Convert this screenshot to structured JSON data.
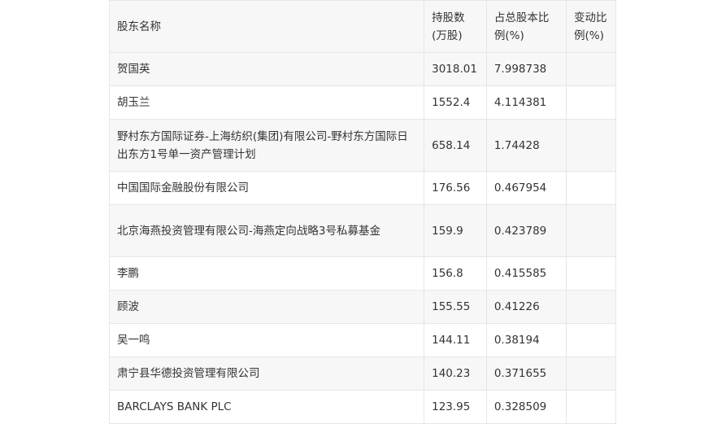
{
  "table": {
    "headers": [
      "股东名称",
      "持股数(万股)",
      "占总股本比例(%)",
      "变动比例(%)"
    ],
    "rows": [
      {
        "name": "贺国英",
        "shares": "3018.01",
        "ratio": "7.998738",
        "change": ""
      },
      {
        "name": "胡玉兰",
        "shares": "1552.4",
        "ratio": "4.114381",
        "change": ""
      },
      {
        "name": "野村东方国际证券-上海纺织(集团)有限公司-野村东方国际日出东方1号单一资产管理计划",
        "shares": "658.14",
        "ratio": "1.74428",
        "change": ""
      },
      {
        "name": "中国国际金融股份有限公司",
        "shares": "176.56",
        "ratio": "0.467954",
        "change": ""
      },
      {
        "name": "北京海燕投资管理有限公司-海燕定向战略3号私募基金",
        "shares": "159.9",
        "ratio": "0.423789",
        "change": ""
      },
      {
        "name": "李鹏",
        "shares": "156.8",
        "ratio": "0.415585",
        "change": ""
      },
      {
        "name": "顾波",
        "shares": "155.55",
        "ratio": "0.41226",
        "change": ""
      },
      {
        "name": "吴一鸣",
        "shares": "144.11",
        "ratio": "0.38194",
        "change": ""
      },
      {
        "name": "肃宁县华德投资管理有限公司",
        "shares": "140.23",
        "ratio": "0.371655",
        "change": ""
      },
      {
        "name": "BARCLAYS BANK PLC",
        "shares": "123.95",
        "ratio": "0.328509",
        "change": ""
      }
    ]
  }
}
